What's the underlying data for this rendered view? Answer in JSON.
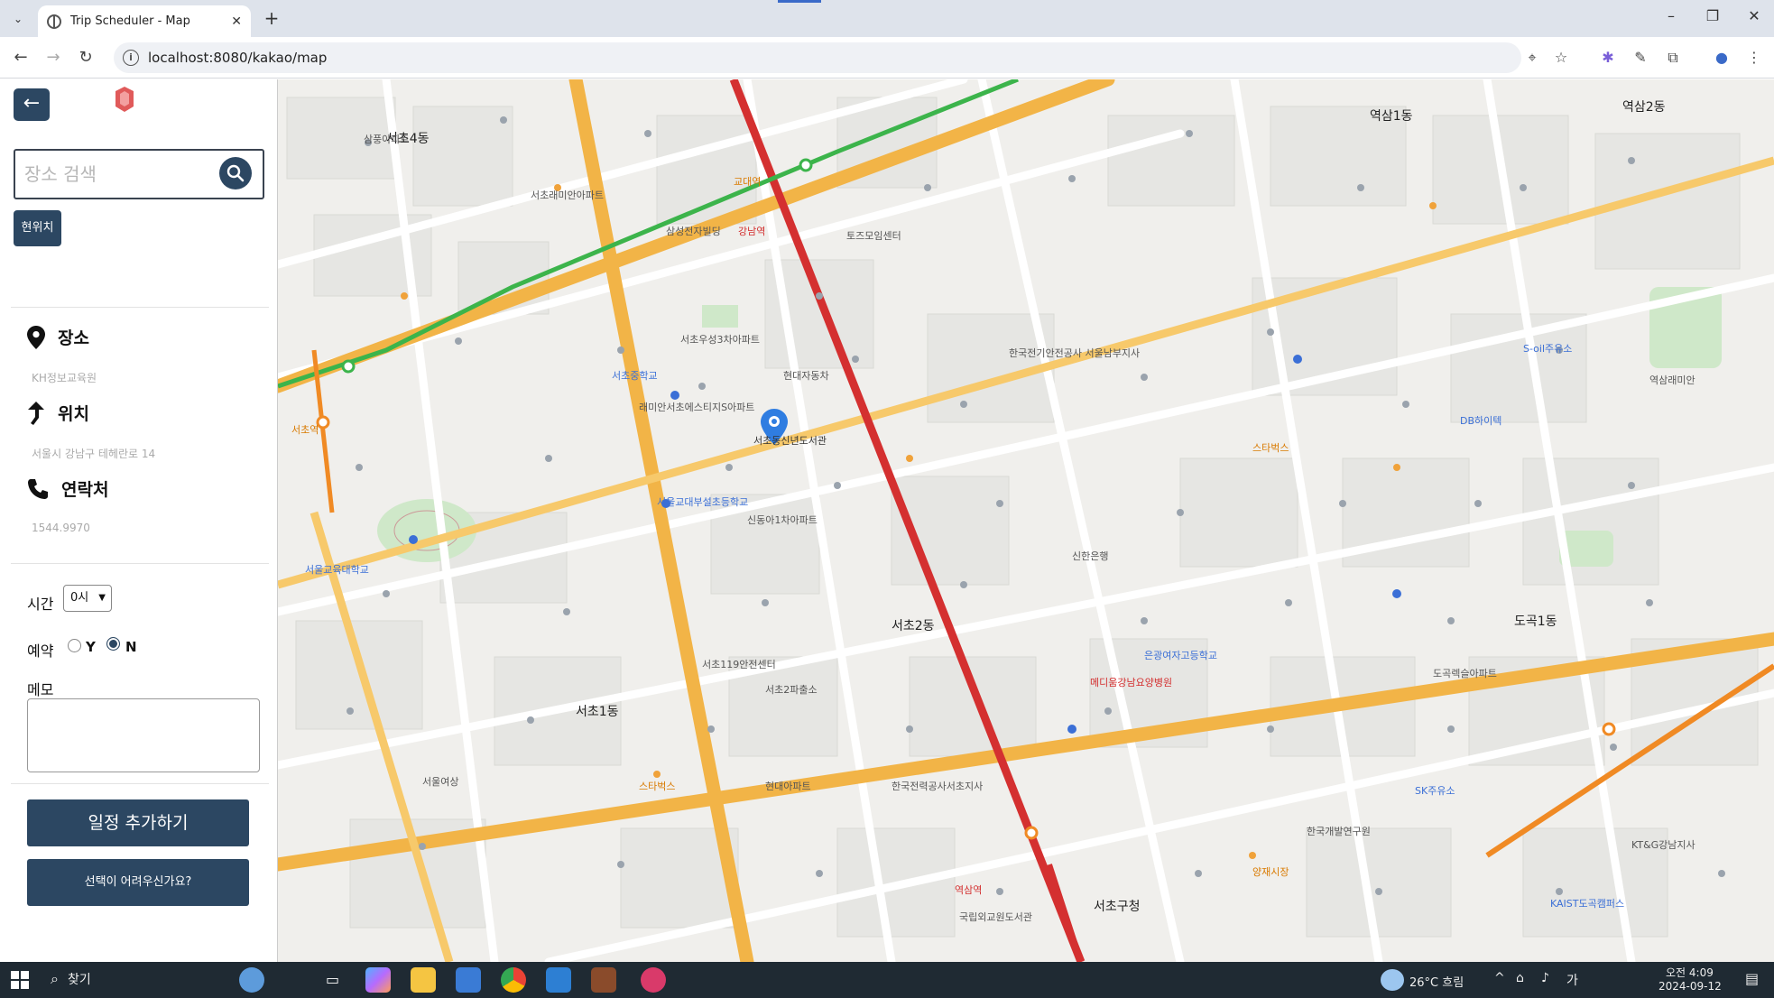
{
  "browser": {
    "tab_title": "Trip Scheduler - Map",
    "url": "localhost:8080/kakao/map"
  },
  "sidebar": {
    "search_placeholder": "장소 검색",
    "current_location_label": "현위치",
    "place": {
      "label": "장소",
      "value": "KH정보교육원"
    },
    "location": {
      "label": "위치",
      "value": "서울시 강남구 테헤란로 14"
    },
    "contact": {
      "label": "연락처",
      "value": "1544.9970"
    },
    "time_label": "시간",
    "time_value": "0시",
    "reservation_label": "예약",
    "reservation_yes": "Y",
    "reservation_no": "N",
    "reservation_selected": "N",
    "memo_label": "메모",
    "memo_value": "",
    "add_schedule_label": "일정 추가하기",
    "help_label": "선택이 어려우신가요?"
  },
  "map": {
    "selected_marker_label": "서초동신년도서관",
    "area_labels": [
      "서초4동",
      "서초1동",
      "서초2동",
      "역삼2동",
      "서초구청",
      "도곡1동",
      "역삼1동"
    ],
    "poi_labels": [
      "삼풍아파트",
      "서초래미안아파트",
      "서울교육대학교",
      "서초역",
      "교대역",
      "강남역",
      "역삼역",
      "서초119안전센터",
      "서초2파출소",
      "서초우성3차아파트",
      "래미안서초에스티지S아파트",
      "서울교대부설초등학교",
      "서초중학교",
      "신동아1차아파트",
      "현대자동차",
      "삼성전자빌딩",
      "토즈모임센터",
      "한국전기안전공사 서울남부지사",
      "은광여자고등학교",
      "메디움강남요양병원",
      "스타벅스",
      "스타벅스",
      "양재시장",
      "국립외교원도서관",
      "KT&G강남지사",
      "S-oil주유소",
      "DB하이텍",
      "서울여상",
      "현대아파트",
      "한국개발연구원",
      "한국전력공사서초지사",
      "SK주유소",
      "신한은행",
      "도곡렉슬아파트",
      "역삼래미안",
      "KAIST도곡캠퍼스"
    ],
    "collapse_icon": "chevron-left-icon"
  },
  "taskbar": {
    "search_label": "찾기",
    "weather": "26°C 흐림",
    "time": "오전 4:09",
    "date": "2024-09-12"
  },
  "colors": {
    "brand": "#2c4762",
    "marker_blue": "#2f7de1",
    "subway_green": "#3cb44b",
    "road_orange": "#f5b04a",
    "road_red": "#d43030"
  }
}
